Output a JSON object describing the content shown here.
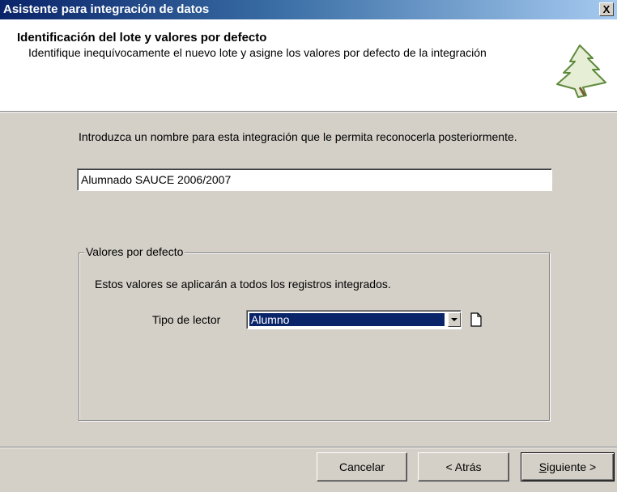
{
  "window": {
    "title": "Asistente para integración de datos",
    "close_label": "X"
  },
  "header": {
    "title": "Identificación del lote y valores por defecto",
    "description": "Identifique inequívocamente el nuevo lote y asigne los valores por defecto de la integración",
    "icon": "tree-icon"
  },
  "main": {
    "intro": "Introduzca un nombre para esta integración que le permita reconocerla posteriormente.",
    "name_value": "Alumnado SAUCE 2006/2007"
  },
  "defaults_group": {
    "legend": "Valores por defecto",
    "note": "Estos valores se aplicarán a todos los registros integrados.",
    "lector_label": "Tipo de lector",
    "lector_value": "Alumno"
  },
  "buttons": {
    "cancel": "Cancelar",
    "back": "< Atrás",
    "next_mnemonic": "S",
    "next_rest": "iguiente >"
  },
  "colors": {
    "title_bar": "#0a246a",
    "dialog_bg": "#d4d0c8",
    "selection": "#0a246a"
  }
}
